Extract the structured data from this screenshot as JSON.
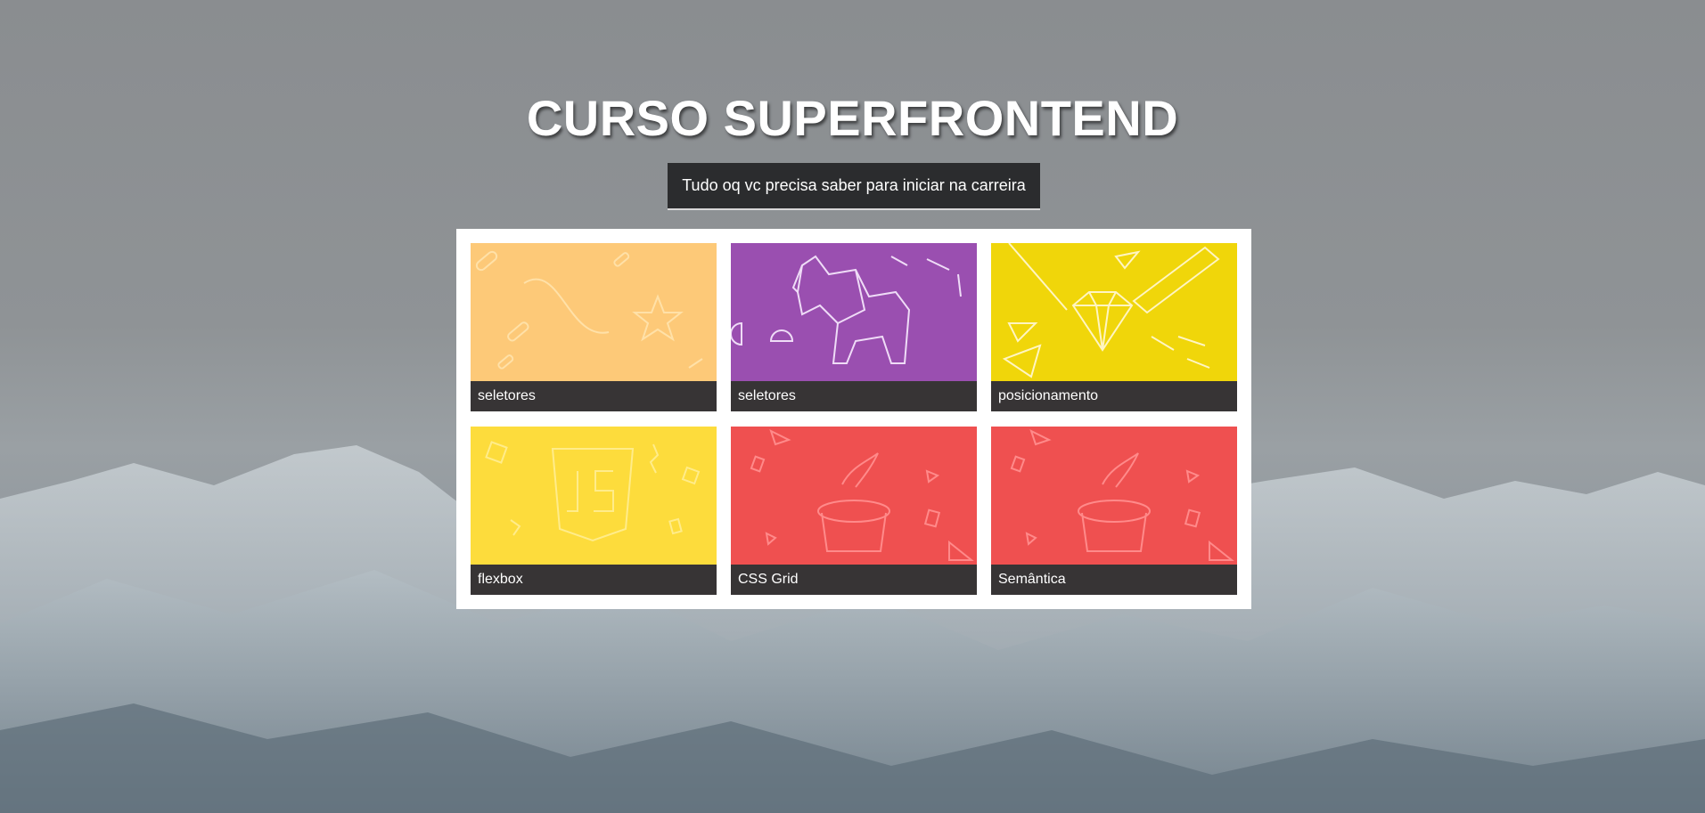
{
  "header": {
    "title": "CURSO SUPERFRONTEND",
    "tagline": "Tudo oq vc precisa saber para iniciar na carreira"
  },
  "cards": [
    {
      "label": "seletores",
      "color": "#fdc978",
      "icon": "line-star-illustration"
    },
    {
      "label": "seletores",
      "color": "#9a4fb0",
      "icon": "origami-elephant-illustration"
    },
    {
      "label": "posicionamento",
      "color": "#f0d60a",
      "icon": "diamond-pencil-illustration"
    },
    {
      "label": "flexbox",
      "color": "#fddc3c",
      "icon": "javascript-shield-illustration"
    },
    {
      "label": "CSS Grid",
      "color": "#ef5050",
      "icon": "magic-hat-illustration"
    },
    {
      "label": "Semântica",
      "color": "#ef5050",
      "icon": "magic-hat-illustration"
    }
  ]
}
